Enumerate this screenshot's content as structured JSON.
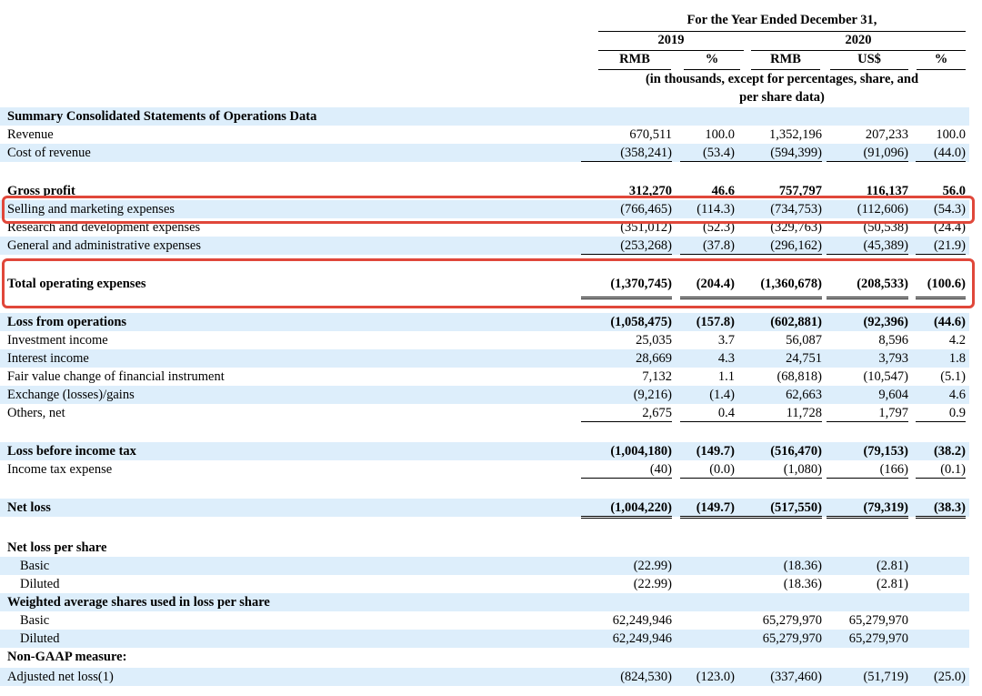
{
  "header": {
    "period": "For the Year Ended December 31,",
    "year1": "2019",
    "year2": "2020",
    "cols": [
      "RMB",
      "%",
      "RMB",
      "US$",
      "%"
    ],
    "units_line1": "(in thousands, except for percentages, share, and",
    "units_line2": "per share data)"
  },
  "rows": [
    {
      "label": "Summary Consolidated Statements of Operations Data",
      "bold": true,
      "values": [
        "",
        "",
        "",
        "",
        ""
      ]
    },
    {
      "label": "Revenue",
      "values": [
        "670,511",
        "100.0",
        "1,352,196",
        "207,233",
        "100.0"
      ]
    },
    {
      "label": "Cost of revenue",
      "values": [
        "(358,241)",
        "(53.4)",
        "(594,399)",
        "(91,096)",
        "(44.0)"
      ]
    },
    {
      "label": "Gross profit",
      "bold": true,
      "values": [
        "312,270",
        "46.6",
        "757,797",
        "116,137",
        "56.0"
      ]
    },
    {
      "label": "Selling and marketing expenses",
      "values": [
        "(766,465)",
        "(114.3)",
        "(734,753)",
        "(112,606)",
        "(54.3)"
      ]
    },
    {
      "label": "Research and development expenses",
      "values": [
        "(351,012)",
        "(52.3)",
        "(329,763)",
        "(50,538)",
        "(24.4)"
      ]
    },
    {
      "label": "General and administrative expenses",
      "values": [
        "(253,268)",
        "(37.8)",
        "(296,162)",
        "(45,389)",
        "(21.9)"
      ]
    },
    {
      "label": "Total operating expenses",
      "bold": true,
      "values": [
        "(1,370,745)",
        "(204.4)",
        "(1,360,678)",
        "(208,533)",
        "(100.6)"
      ]
    },
    {
      "label": "Loss from operations",
      "bold": true,
      "values": [
        "(1,058,475)",
        "(157.8)",
        "(602,881)",
        "(92,396)",
        "(44.6)"
      ]
    },
    {
      "label": "Investment income",
      "values": [
        "25,035",
        "3.7",
        "56,087",
        "8,596",
        "4.2"
      ]
    },
    {
      "label": "Interest income",
      "values": [
        "28,669",
        "4.3",
        "24,751",
        "3,793",
        "1.8"
      ]
    },
    {
      "label": "Fair value change of financial instrument",
      "values": [
        "7,132",
        "1.1",
        "(68,818)",
        "(10,547)",
        "(5.1)"
      ]
    },
    {
      "label": "Exchange (losses)/gains",
      "values": [
        "(9,216)",
        "(1.4)",
        "62,663",
        "9,604",
        "4.6"
      ]
    },
    {
      "label": "Others, net",
      "values": [
        "2,675",
        "0.4",
        "11,728",
        "1,797",
        "0.9"
      ]
    },
    {
      "label": "Loss before income tax",
      "bold": true,
      "values": [
        "(1,004,180)",
        "(149.7)",
        "(516,470)",
        "(79,153)",
        "(38.2)"
      ]
    },
    {
      "label": "Income tax expense",
      "values": [
        "(40)",
        "(0.0)",
        "(1,080)",
        "(166)",
        "(0.1)"
      ]
    },
    {
      "label": "Net loss",
      "bold": true,
      "values": [
        "(1,004,220)",
        "(149.7)",
        "(517,550)",
        "(79,319)",
        "(38.3)"
      ]
    },
    {
      "label": "Net loss per share",
      "bold": true,
      "values": [
        "",
        "",
        "",
        "",
        ""
      ]
    },
    {
      "label": "Basic",
      "indent": true,
      "values": [
        "(22.99)",
        "",
        "(18.36)",
        "(2.81)",
        ""
      ]
    },
    {
      "label": "Diluted",
      "indent": true,
      "values": [
        "(22.99)",
        "",
        "(18.36)",
        "(2.81)",
        ""
      ]
    },
    {
      "label": "Weighted average shares used in loss per share",
      "bold": true,
      "values": [
        "",
        "",
        "",
        "",
        ""
      ]
    },
    {
      "label": "Basic",
      "indent": true,
      "values": [
        "62,249,946",
        "",
        "65,279,970",
        "65,279,970",
        ""
      ]
    },
    {
      "label": "Diluted",
      "indent": true,
      "values": [
        "62,249,946",
        "",
        "65,279,970",
        "65,279,970",
        ""
      ]
    },
    {
      "label": "Non-GAAP measure:",
      "bold": true,
      "values": [
        "",
        "",
        "",
        "",
        ""
      ]
    },
    {
      "label": "Adjusted net loss(1)",
      "values": [
        "(824,530)",
        "(123.0)",
        "(337,460)",
        "(51,719)",
        "(25.0)"
      ]
    }
  ],
  "highlight_color": "#e0473a",
  "shade_color": "#ddeefb"
}
